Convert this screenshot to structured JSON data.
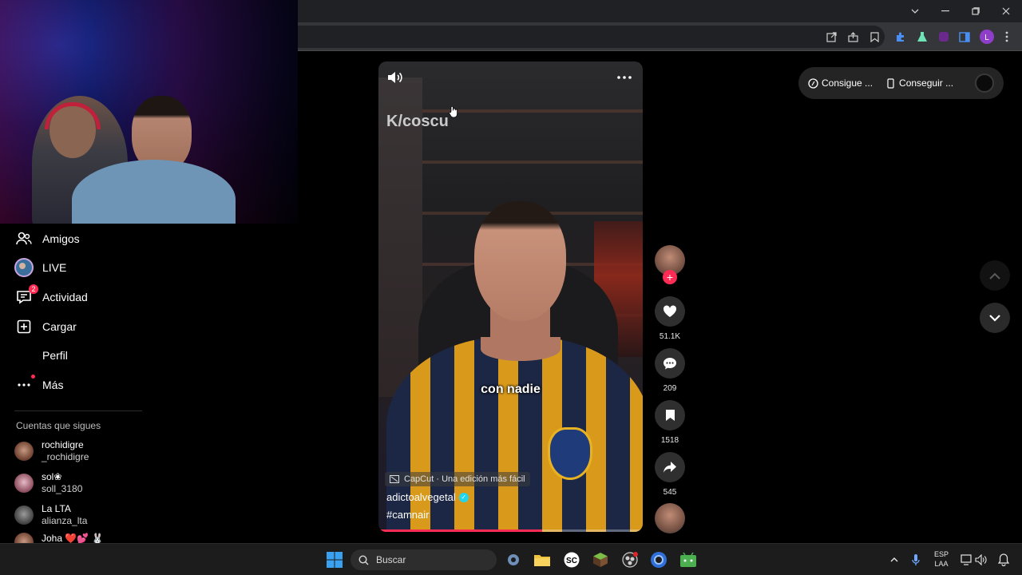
{
  "sidebar": {
    "items": [
      {
        "label": "Amigos",
        "icon": "friends-icon"
      },
      {
        "label": "LIVE",
        "icon": "live-icon"
      },
      {
        "label": "Actividad",
        "icon": "activity-icon",
        "badge": "2"
      },
      {
        "label": "Cargar",
        "icon": "upload-icon"
      },
      {
        "label": "Perfil",
        "icon": "profile-icon"
      },
      {
        "label": "Más",
        "icon": "more-icon"
      }
    ],
    "following_title": "Cuentas que sigues",
    "following": [
      {
        "name": "rochidigre",
        "handle": "_rochidigre"
      },
      {
        "name": "sol❀",
        "handle": "soll_3180"
      },
      {
        "name": "La LTA",
        "handle": "alianza_lta"
      },
      {
        "name": "Joha ❤️💕 🐰",
        "handle": ""
      }
    ]
  },
  "video": {
    "watermark": "K/coscu",
    "subtitle": "con nadie",
    "capcut": "CapCut · Una edición más fácil",
    "author": "adictoalvegetal",
    "hashtag": "#camnair",
    "progress": 0.62
  },
  "actions": {
    "likes": "51.1K",
    "comments": "209",
    "saves": "1518",
    "shares": "545"
  },
  "pills": {
    "first": "Consigue ...",
    "second": "Conseguir ..."
  },
  "taskbar": {
    "search_placeholder": "Buscar",
    "lang_line1": "ESP",
    "lang_line2": "LAA"
  },
  "colors": {
    "accent": "#fe2c55",
    "verified": "#20d5ec",
    "background": "#000000"
  }
}
